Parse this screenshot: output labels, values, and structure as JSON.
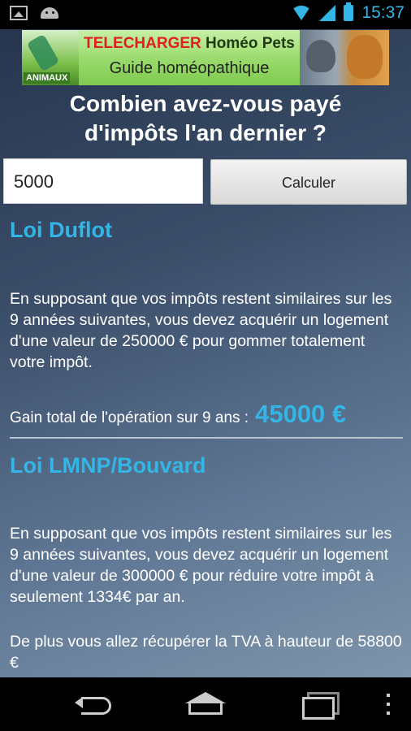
{
  "status_bar": {
    "time": "15:37",
    "icons": [
      "image-notification-icon",
      "android-notification-icon",
      "wifi-icon",
      "signal-icon",
      "battery-icon"
    ]
  },
  "banner": {
    "left_label": "ANIMAUX",
    "title_red": "TELECHARGER",
    "title_dark": "Homéo Pets",
    "subtitle": "Guide homéopathique"
  },
  "question": {
    "line1": "Combien avez-vous payé",
    "line2": "d'impôts l'an dernier ?"
  },
  "form": {
    "amount_value": "5000",
    "calculate_label": "Calculer"
  },
  "sections": {
    "duflot": {
      "title": "Loi Duflot",
      "text": "En supposant que vos impôts restent similaires sur les 9 années suivantes, vous devez acquérir un logement d'une valeur de 250000 € pour gommer totalement votre impôt.",
      "gain_label": "Gain total de l'opération sur 9 ans :",
      "gain_value": "45000 €"
    },
    "lmnp": {
      "title": "Loi LMNP/Bouvard",
      "text": "En supposant que vos impôts restent similaires sur les 9 années suivantes, vous devez acquérir un logement d'une valeur de 300000 € pour réduire votre impôt à seulement 1334€ par an.",
      "text2": "De plus vous allez récupérer la TVA à hauteur de 58800 €"
    }
  },
  "colors": {
    "accent": "#33b5e5",
    "text": "#ffffff"
  },
  "nav_bar": [
    "back-icon",
    "home-icon",
    "recent-apps-icon",
    "menu-icon"
  ]
}
